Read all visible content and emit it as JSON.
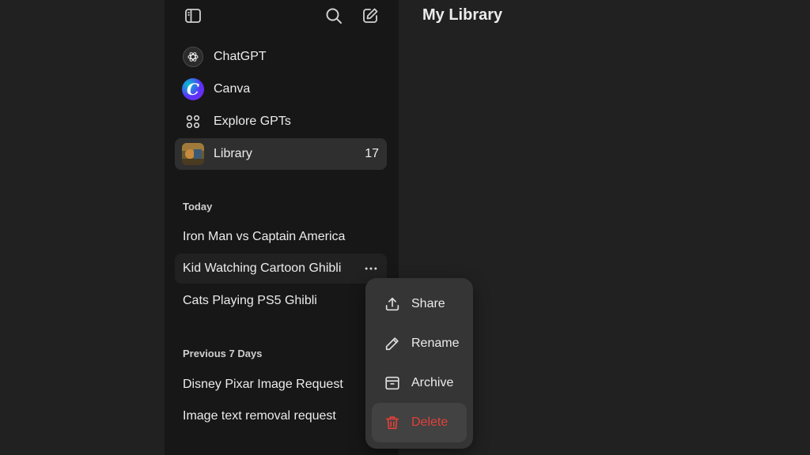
{
  "header": {
    "title": "My Library"
  },
  "sidebar": {
    "nav": [
      {
        "label": "ChatGPT",
        "icon": "chatgpt-logo-icon"
      },
      {
        "label": "Canva",
        "icon": "canva-logo-icon",
        "glyph": "C"
      },
      {
        "label": "Explore GPTs",
        "icon": "grid-dots-icon"
      },
      {
        "label": "Library",
        "icon": "library-thumbnail-icon",
        "count": "17"
      }
    ],
    "sections": [
      {
        "label": "Today",
        "items": [
          "Iron Man vs Captain America",
          "Kid Watching Cartoon Ghibli",
          "Cats Playing PS5 Ghibli"
        ]
      },
      {
        "label": "Previous 7 Days",
        "items": [
          "Disney Pixar Image Request",
          "Image text removal request"
        ]
      }
    ]
  },
  "context_menu": {
    "items": [
      {
        "label": "Share",
        "icon": "share-upload-icon"
      },
      {
        "label": "Rename",
        "icon": "pencil-icon"
      },
      {
        "label": "Archive",
        "icon": "archive-box-icon"
      },
      {
        "label": "Delete",
        "icon": "trash-icon"
      }
    ]
  },
  "colors": {
    "sidebar_bg": "#171717",
    "main_bg": "#212121",
    "menu_bg": "#353535",
    "danger": "#e0413a"
  }
}
